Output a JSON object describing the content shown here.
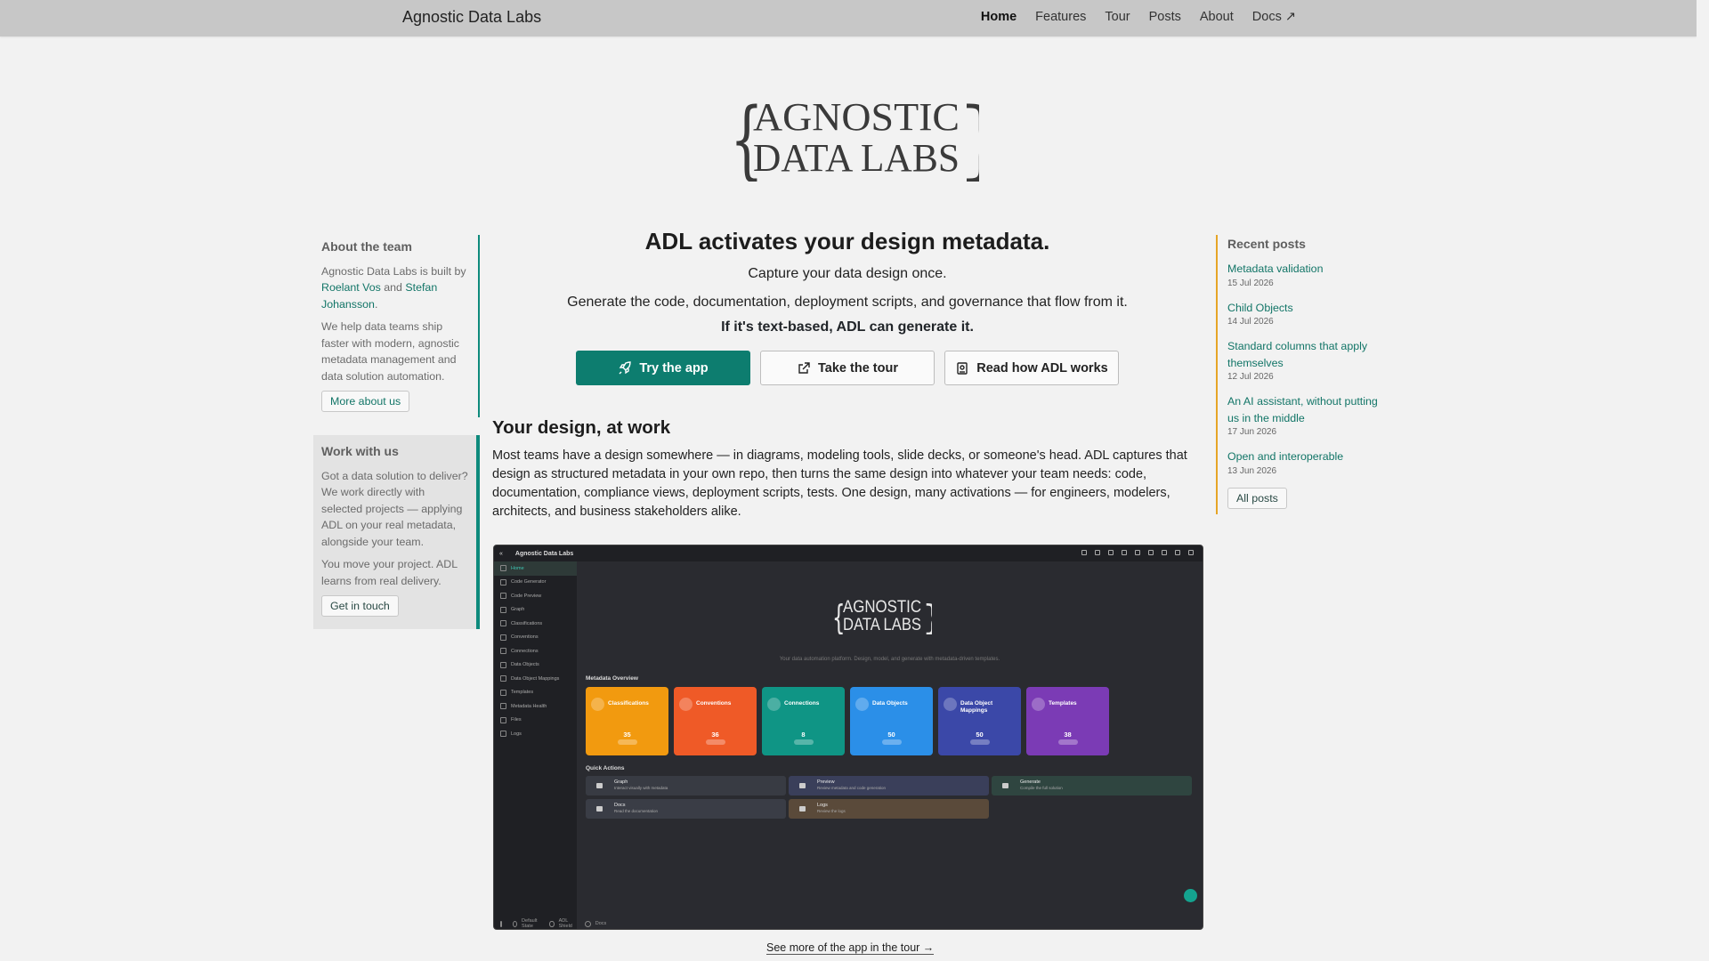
{
  "navbar": {
    "brand": "Agnostic Data Labs",
    "links": [
      {
        "label": "Home"
      },
      {
        "label": "Features"
      },
      {
        "label": "Tour"
      },
      {
        "label": "Posts"
      },
      {
        "label": "About"
      },
      {
        "label": "Docs ↗"
      }
    ]
  },
  "logo": {
    "line1": "AGNOSTIC",
    "line2": "DATA LABS"
  },
  "left": {
    "about": {
      "title": "About the team",
      "text_pre": "Agnostic Data Labs is built by ",
      "person1": "Roelant Vos",
      "text_mid": " and ",
      "person2": "Stefan Johansson",
      "text_post": ".",
      "text2": "We help data teams ship faster with modern, agnostic metadata management and data solution automation.",
      "button": "More about us"
    },
    "work": {
      "title": "Work with us",
      "text1": "Got a data solution to deliver? We work directly with selected projects — applying ADL on your real metadata, alongside your team.",
      "text2": "You move your project. ADL learns from real delivery.",
      "button": "Get in touch"
    }
  },
  "hero": {
    "headline": "ADL activates your design metadata.",
    "line1": "Capture your data design once.",
    "line2": "Generate the code, documentation, deployment scripts, and governance that flow from it.",
    "bold": "If it's text-based, ADL can generate it.",
    "btn_try": "Try the app",
    "btn_tour": "Take the tour",
    "btn_read": "Read how ADL works"
  },
  "design": {
    "title": "Your design, at work",
    "text": "Most teams have a design somewhere — in diagrams, modeling tools, slide decks, or someone's head. ADL captures that design as structured metadata in your own repo, then turns the same design into whatever your team needs: code, documentation, compliance views, deployment scripts, tests. One design, many activations — for engineers, modelers, architects, and business stakeholders alike.",
    "tour_link": "See more of the app in the tour →"
  },
  "app": {
    "title": "Agnostic Data Labs",
    "tagline": "Your data automation platform. Design, model, and generate with metadata-driven templates.",
    "sidebar": [
      "Home",
      "Code Generator",
      "Code Preview",
      "Graph",
      "Classifications",
      "Conventions",
      "Connections",
      "Data Objects",
      "Data Object Mappings",
      "Templates",
      "Metadata Health",
      "Files",
      "Logs"
    ],
    "sidebar_bottom": [
      "Default State",
      "ADL Shield",
      "Docs"
    ],
    "overview_label": "Metadata Overview",
    "cards": [
      {
        "label": "Classifications",
        "value": "35",
        "color": "#f29a0f"
      },
      {
        "label": "Conventions",
        "value": "36",
        "color": "#ef5a27"
      },
      {
        "label": "Connections",
        "value": "8",
        "color": "#0f9585"
      },
      {
        "label": "Data Objects",
        "value": "50",
        "color": "#2b8fe8"
      },
      {
        "label": "Data Object Mappings",
        "value": "50",
        "color": "#3b48a8"
      },
      {
        "label": "Templates",
        "value": "38",
        "color": "#7b3bb5"
      }
    ],
    "quick_label": "Quick Actions",
    "quick": [
      {
        "t": "Graph",
        "s": "Interact visually with metadata",
        "bg": "#383b43"
      },
      {
        "t": "Preview",
        "s": "Review metadata and code generation",
        "bg": "#3a3f5a"
      },
      {
        "t": "Generate",
        "s": "Compile the full solution",
        "bg": "#2f4540"
      },
      {
        "t": "Docs",
        "s": "Read the documentation",
        "bg": "#3a3d46"
      },
      {
        "t": "Logs",
        "s": "Review the logs",
        "bg": "#5a4a3a"
      }
    ]
  },
  "posts": {
    "title": "Recent posts",
    "items": [
      {
        "title": "Metadata validation",
        "date": "15 Jul 2026"
      },
      {
        "title": "Child Objects",
        "date": "14 Jul 2026"
      },
      {
        "title": "Standard columns that apply themselves",
        "date": "12 Jul 2026"
      },
      {
        "title": "An AI assistant, without putting us in the middle",
        "date": "17 Jun 2026"
      },
      {
        "title": "Open and interoperable",
        "date": "13 Jun 2026"
      }
    ],
    "button": "All posts"
  },
  "colors": {
    "accent": "#0d7d6f",
    "posts_border": "#e6a527"
  }
}
